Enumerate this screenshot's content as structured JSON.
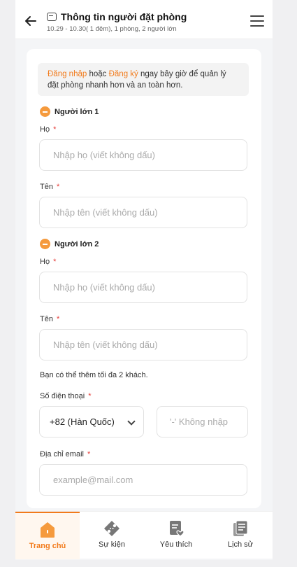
{
  "header": {
    "title": "Thông tin người đặt phòng",
    "subtitle": "10.29 - 10.30( 1 đêm), 1 phòng, 2 người lớn"
  },
  "notice": {
    "login_link": "Đăng nhập",
    "or_text": " hoặc ",
    "register_link": "Đăng ký",
    "rest": " ngay bây giờ để quản lý đặt phòng nhanh hơn và an toàn hơn."
  },
  "guests": [
    {
      "section": "Người lớn 1",
      "last_name_label": "Họ",
      "last_name_placeholder": "Nhập họ (viết không dấu)",
      "first_name_label": "Tên",
      "first_name_placeholder": "Nhập tên (viết không dấu)"
    },
    {
      "section": "Người lớn 2",
      "last_name_label": "Họ",
      "last_name_placeholder": "Nhập họ (viết không dấu)",
      "first_name_label": "Tên",
      "first_name_placeholder": "Nhập tên (viết không dấu)"
    }
  ],
  "required_mark": "*",
  "hint": "Bạn có thể thêm tối đa 2 khách.",
  "phone": {
    "label": "Số điện thoại",
    "country_code": "+82 (Hàn Quốc)",
    "placeholder": "'-' Không nhập"
  },
  "email": {
    "label": "Địa chỉ email",
    "placeholder": "example@mail.com"
  },
  "tabbar": [
    {
      "label": "Trang chủ",
      "icon": "home-icon",
      "active": true
    },
    {
      "label": "Sự kiện",
      "icon": "ticket-icon",
      "active": false
    },
    {
      "label": "Yêu thích",
      "icon": "favorite-doc-icon",
      "active": false
    },
    {
      "label": "Lịch sử",
      "icon": "history-icon",
      "active": false
    }
  ],
  "colors": {
    "accent": "#f27a1a",
    "minus_badge": "#f59a3d",
    "required": "#e53935"
  }
}
